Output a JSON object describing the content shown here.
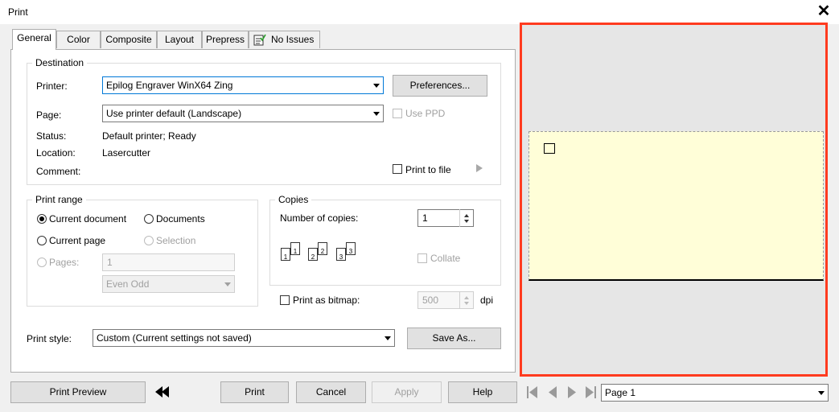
{
  "window": {
    "title": "Print"
  },
  "tabs": [
    {
      "label": "General"
    },
    {
      "label": "Color"
    },
    {
      "label": "Composite"
    },
    {
      "label": "Layout"
    },
    {
      "label": "Prepress"
    },
    {
      "label": "No Issues",
      "icon": "checklist-icon"
    }
  ],
  "destination": {
    "group_label": "Destination",
    "printer_label": "Printer:",
    "printer_value": "Epilog Engraver WinX64 Zing",
    "preferences_button": "Preferences...",
    "page_label": "Page:",
    "page_value": "Use printer default (Landscape)",
    "use_ppd": "Use PPD",
    "status_label": "Status:",
    "status_value": "Default printer; Ready",
    "location_label": "Location:",
    "location_value": "Lasercutter",
    "comment_label": "Comment:",
    "print_to_file": "Print to file"
  },
  "print_range": {
    "group_label": "Print range",
    "current_document": "Current document",
    "documents": "Documents",
    "current_page": "Current page",
    "selection": "Selection",
    "pages_label": "Pages:",
    "pages_value": "1",
    "even_odd": "Even Odd"
  },
  "copies": {
    "group_label": "Copies",
    "number_label": "Number of copies:",
    "number_value": "1",
    "collate": "Collate"
  },
  "bitmap": {
    "label": "Print as bitmap:",
    "dpi_value": "500",
    "dpi_unit": "dpi"
  },
  "print_style": {
    "label": "Print style:",
    "value": "Custom (Current settings not saved)",
    "save_as": "Save As..."
  },
  "footer": {
    "print_preview": "Print Preview",
    "print": "Print",
    "cancel": "Cancel",
    "apply": "Apply",
    "help": "Help",
    "page_select": "Page 1"
  },
  "colors": {
    "highlight": "#ff3b1f",
    "paper": "#fffed8",
    "preview_bg": "#e6e6e6"
  }
}
